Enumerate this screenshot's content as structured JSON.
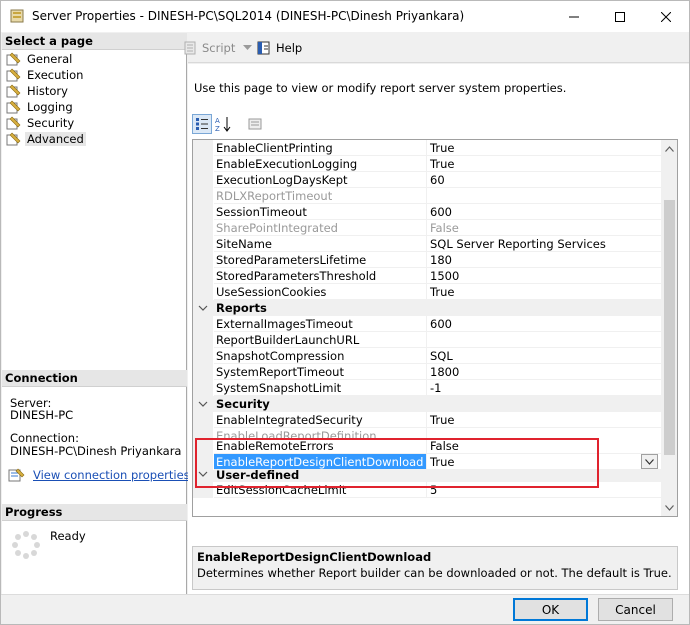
{
  "window": {
    "title": "Server Properties - DINESH-PC\\SQL2014 (DINESH-PC\\Dinesh Priyankara)"
  },
  "left": {
    "select_page_header": "Select a page",
    "pages": [
      {
        "label": "General"
      },
      {
        "label": "Execution"
      },
      {
        "label": "History"
      },
      {
        "label": "Logging"
      },
      {
        "label": "Security"
      },
      {
        "label": "Advanced"
      }
    ],
    "connection_header": "Connection",
    "server_label": "Server:",
    "server_value": "DINESH-PC",
    "connection_label": "Connection:",
    "connection_value": "DINESH-PC\\Dinesh Priyankara",
    "view_link": "View connection properties",
    "progress_header": "Progress",
    "progress_status": "Ready"
  },
  "toolbar": {
    "script_label": "Script",
    "help_label": "Help"
  },
  "main": {
    "description": "Use this page to view or modify report server system properties."
  },
  "grid": {
    "rows": [
      {
        "name": "EnableClientPrinting",
        "value": "True"
      },
      {
        "name": "EnableExecutionLogging",
        "value": "True"
      },
      {
        "name": "ExecutionLogDaysKept",
        "value": "60"
      },
      {
        "name": "RDLXReportTimeout",
        "value": ""
      },
      {
        "name": "SessionTimeout",
        "value": "600"
      },
      {
        "name": "SharePointIntegrated",
        "value": "False"
      },
      {
        "name": "SiteName",
        "value": "SQL Server Reporting Services"
      },
      {
        "name": "StoredParametersLifetime",
        "value": "180"
      },
      {
        "name": "StoredParametersThreshold",
        "value": "1500"
      },
      {
        "name": "UseSessionCookies",
        "value": "True"
      },
      {
        "category": "Reports"
      },
      {
        "name": "ExternalImagesTimeout",
        "value": "600"
      },
      {
        "name": "ReportBuilderLaunchURL",
        "value": ""
      },
      {
        "name": "SnapshotCompression",
        "value": "SQL"
      },
      {
        "name": "SystemReportTimeout",
        "value": "1800"
      },
      {
        "name": "SystemSnapshotLimit",
        "value": "-1"
      },
      {
        "category": "Security"
      },
      {
        "name": "EnableIntegratedSecurity",
        "value": "True"
      },
      {
        "name": "EnableLoadReportDefinition",
        "value": ""
      },
      {
        "name": "EnableRemoteErrors",
        "value": "False"
      },
      {
        "name": "EnableReportDesignClientDownload",
        "value": "True"
      },
      {
        "category": "User-defined"
      },
      {
        "name": "EditSessionCacheLimit",
        "value": "5"
      }
    ]
  },
  "help": {
    "title": "EnableReportDesignClientDownload",
    "description": "Determines whether Report builder can be downloaded or not. The default is True."
  },
  "buttons": {
    "ok": "OK",
    "cancel": "Cancel"
  }
}
